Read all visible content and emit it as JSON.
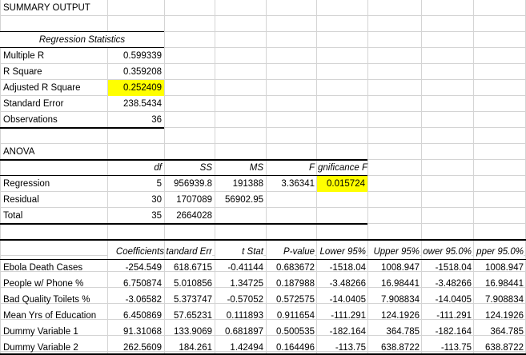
{
  "title": "SUMMARY OUTPUT",
  "regression_statistics": {
    "header": "Regression Statistics",
    "rows": [
      {
        "label": "Multiple R",
        "value": "0.599339"
      },
      {
        "label": "R Square",
        "value": "0.359208"
      },
      {
        "label": "Adjusted R Square",
        "value": "0.252409"
      },
      {
        "label": "Standard Error",
        "value": "238.5434"
      },
      {
        "label": "Observations",
        "value": "36"
      }
    ]
  },
  "anova": {
    "title": "ANOVA",
    "headers": [
      "df",
      "SS",
      "MS",
      "F",
      "gnificance F"
    ],
    "rows": [
      {
        "label": "Regression",
        "df": "5",
        "ss": "956939.8",
        "ms": "191388",
        "f": "3.36341",
        "sig": "0.015724"
      },
      {
        "label": "Residual",
        "df": "30",
        "ss": "1707089",
        "ms": "56902.95",
        "f": "",
        "sig": ""
      },
      {
        "label": "Total",
        "df": "35",
        "ss": "2664028",
        "ms": "",
        "f": "",
        "sig": ""
      }
    ]
  },
  "coefficients": {
    "headers": [
      "Coefficients",
      "tandard Err",
      "t Stat",
      "P-value",
      "Lower 95%",
      "Upper 95%",
      "ower 95.0%",
      "pper 95.0%"
    ],
    "rows": [
      {
        "label": "Ebola Death Cases",
        "values": [
          "-254.549",
          "618.6715",
          "-0.41144",
          "0.683672",
          "-1518.04",
          "1008.947",
          "-1518.04",
          "1008.947"
        ]
      },
      {
        "label": "People w/ Phone %",
        "values": [
          "6.750874",
          "5.010856",
          "1.34725",
          "0.187988",
          "-3.48266",
          "16.98441",
          "-3.48266",
          "16.98441"
        ]
      },
      {
        "label": "Bad Quality Toilets %",
        "values": [
          "-3.06582",
          "5.373747",
          "-0.57052",
          "0.572575",
          "-14.0405",
          "7.908834",
          "-14.0405",
          "7.908834"
        ]
      },
      {
        "label": "Mean Yrs of Education",
        "values": [
          "6.450869",
          "57.65231",
          "0.111893",
          "0.911654",
          "-111.291",
          "124.1926",
          "-111.291",
          "124.1926"
        ]
      },
      {
        "label": "Dummy Variable 1",
        "values": [
          "91.31068",
          "133.9069",
          "0.681897",
          "0.500535",
          "-182.164",
          "364.785",
          "-182.164",
          "364.785"
        ]
      },
      {
        "label": "Dummy Variable 2",
        "values": [
          "262.5609",
          "184.261",
          "1.42494",
          "0.164496",
          "-113.75",
          "638.8722",
          "-113.75",
          "638.8722"
        ]
      }
    ]
  },
  "colors": {
    "highlight": "#ffff00",
    "gridline": "#d4d4d4"
  }
}
